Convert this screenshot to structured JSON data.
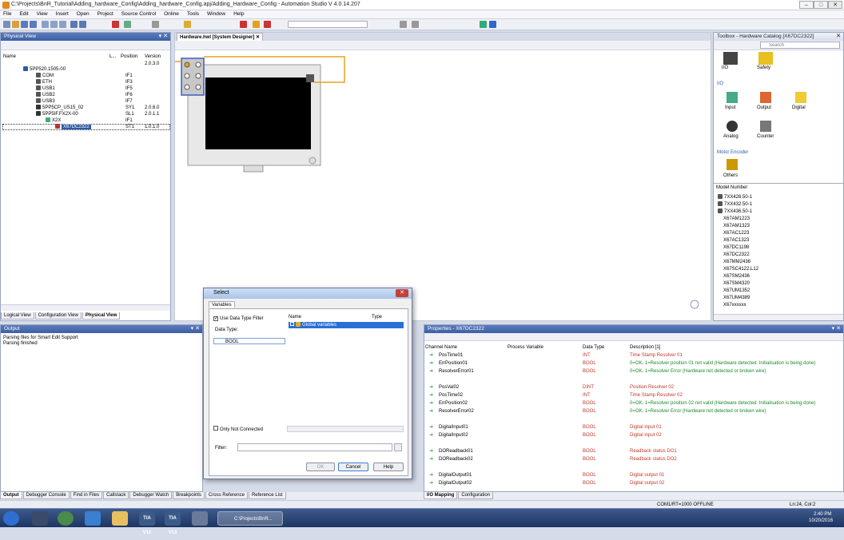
{
  "window": {
    "title": "C:\\Projects\\BnR_Tutorial\\Adding_hardware_Config\\Adding_hardware_Config.apj/Adding_Hardware_Config - Automation Studio V 4.0.14.207",
    "min": "–",
    "max": "□",
    "close": "✕"
  },
  "menu": [
    "File",
    "Edit",
    "View",
    "Insert",
    "Open",
    "Project",
    "Source Control",
    "Online",
    "Tools",
    "Window",
    "Help"
  ],
  "physical_view": {
    "title": "Physical View",
    "columns": {
      "name": "Name",
      "l": "L...",
      "position": "Position",
      "version": "Version"
    },
    "rows": [
      {
        "name": "",
        "position": "",
        "version": "2.0.3.0"
      },
      {
        "name": "5PP520.1505-00",
        "position": "",
        "version": ""
      },
      {
        "name": "COM",
        "position": "IF1",
        "version": ""
      },
      {
        "name": "ETH",
        "position": "IF3",
        "version": ""
      },
      {
        "name": "USB1",
        "position": "IF5",
        "version": ""
      },
      {
        "name": "USB2",
        "position": "IF6",
        "version": ""
      },
      {
        "name": "USB3",
        "position": "IF7",
        "version": ""
      },
      {
        "name": "5PP5CP_US15_02",
        "position": "SY1",
        "version": "2.0.6.0"
      },
      {
        "name": "5PP5IF.FX2X-00",
        "position": "SL1",
        "version": "2.0.1.1"
      },
      {
        "name": "X2X",
        "position": "IF1",
        "version": ""
      },
      {
        "name": "X67DC2322",
        "position": "ST1",
        "version": "1.0.1.0"
      }
    ],
    "tabs": [
      "Logical View",
      "Configuration View",
      "Physical View"
    ]
  },
  "designer": {
    "tab": "Hardware.hwl [System Designer]"
  },
  "toolbox": {
    "title": "Toolbox - Hardware Catalog [X67DC2322]",
    "search_placeholder": "Search",
    "top_items": [
      "I/O",
      "Safety"
    ],
    "io_header": "I/O",
    "io_items": [
      "Input",
      "Output",
      "Digital",
      "Analog",
      "Counter"
    ],
    "motor_header": "Motor Encoder",
    "others": "Others",
    "model_header": "Model Number",
    "models": [
      "7XX426.50-1",
      "7XX432.50-1",
      "7XX436.50-1",
      "X67AM1223",
      "X67AM1323",
      "X67AC1223",
      "X67AC1323",
      "X67DC1198",
      "X67DC2322",
      "X67MM2436",
      "X67SC4122.L12",
      "X67SM2436",
      "X67SM4320",
      "X67UM1352",
      "X67UM4389",
      "X67xxxxxx"
    ]
  },
  "output": {
    "title": "Output",
    "lines": [
      "Parsing files for Smart Edit Support",
      "Parsing finished"
    ],
    "tabs": [
      "Output",
      "Debugger Console",
      "Find in Files",
      "Callstack",
      "Debugger Watch",
      "Breakpoints",
      "Cross Reference",
      "Reference List"
    ]
  },
  "dialog": {
    "title": "Select",
    "tab": "Variables",
    "use_filter": "Use Data Type Filter",
    "data_type_label": "Data Type:",
    "data_type_value": "BOOL",
    "col_name": "Name",
    "col_type": "Type",
    "global_vars": "Global variables",
    "only_not_connected": "Only Not Connected",
    "filter_label": "Filter:",
    "ok": "OK",
    "cancel": "Cancel",
    "help": "Help"
  },
  "properties": {
    "title": "Properties - X67DC2322",
    "columns": {
      "channel": "Channel Name",
      "process": "Process Variable",
      "datatype": "Data Type",
      "desc": "Description [1]"
    },
    "rows": [
      {
        "ch": "PosTime01",
        "dt": "INT",
        "desc": "Time Stamp Resolver 01",
        "green": false
      },
      {
        "ch": "ErrPosition01",
        "dt": "BOOL",
        "desc": "0=OK, 1=Resolver position 01 not valid (Hardware detected. Initialisation is being done)",
        "green": true
      },
      {
        "ch": "ResolverError01",
        "dt": "BOOL",
        "desc": "0=OK, 1=Resolver Error (Hardware not detected or broken wire)",
        "green": true
      },
      {
        "ch": "",
        "dt": "",
        "desc": "",
        "green": false
      },
      {
        "ch": "PosVal02",
        "dt": "DINT",
        "desc": "Position Resolver 02",
        "green": false
      },
      {
        "ch": "PosTime02",
        "dt": "INT",
        "desc": "Time Stamp Resolver 02",
        "green": false
      },
      {
        "ch": "ErrPosition02",
        "dt": "BOOL",
        "desc": "0=OK, 1=Resolver position 02 not valid (Hardware detected. Initialisation is being done)",
        "green": true
      },
      {
        "ch": "ResolverError02",
        "dt": "BOOL",
        "desc": "0=OK, 1=Resolver Error (Hardware not detected or broken wire)",
        "green": true
      },
      {
        "ch": "",
        "dt": "",
        "desc": "",
        "green": false
      },
      {
        "ch": "DigitalInput01",
        "dt": "BOOL",
        "desc": "Digital input 01",
        "green": false
      },
      {
        "ch": "DigitalInput02",
        "dt": "BOOL",
        "desc": "Digital input 02",
        "green": false
      },
      {
        "ch": "",
        "dt": "",
        "desc": "",
        "green": false
      },
      {
        "ch": "DOReadback01",
        "dt": "BOOL",
        "desc": "Readback status DO1",
        "green": false
      },
      {
        "ch": "DOReadback02",
        "dt": "BOOL",
        "desc": "Readback status DO2",
        "green": false
      },
      {
        "ch": "",
        "dt": "",
        "desc": "",
        "green": false
      },
      {
        "ch": "DigitalOutput01",
        "dt": "BOOL",
        "desc": "Digital output 01",
        "green": false
      },
      {
        "ch": "DigitalOutput02",
        "dt": "BOOL",
        "desc": "Digital output 02",
        "green": false
      }
    ],
    "tabs": [
      "I/O Mapping",
      "Configuration"
    ]
  },
  "status": {
    "mode": "COM1/RT=1000  OFFLINE",
    "cursor": "Ln:24, Col:2"
  },
  "taskbar": {
    "active_task": "C:\\Projects\\BnR...",
    "time": "2:40 PM",
    "date": "10/20/2016",
    "tia1": "TIA V12",
    "tia2": "TIA V13"
  }
}
